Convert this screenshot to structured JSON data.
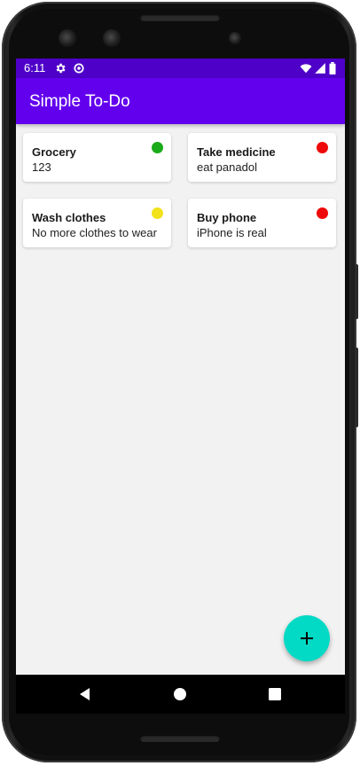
{
  "status_bar": {
    "time": "6:11",
    "background": "#4e00c8",
    "icons": [
      "settings-icon",
      "data-saver-icon",
      "wifi-icon",
      "cell-signal-icon",
      "battery-icon"
    ]
  },
  "app_bar": {
    "title": "Simple To-Do",
    "background": "#6200ee"
  },
  "tasks": [
    {
      "title": "Grocery",
      "description": "123",
      "status_color": "#1aab1a",
      "status": "green"
    },
    {
      "title": "Take medicine",
      "description": "eat panadol",
      "status_color": "#ee0a0a",
      "status": "red"
    },
    {
      "title": "Wash clothes",
      "description": "No more clothes to wear",
      "status_color": "#f2e21a",
      "status": "yellow"
    },
    {
      "title": "Buy phone",
      "description": "iPhone is real",
      "status_color": "#ee0a0a",
      "status": "red"
    }
  ],
  "fab": {
    "icon": "add-icon",
    "color": "#03dac5"
  },
  "nav": {
    "buttons": [
      "back-icon",
      "home-icon",
      "recents-icon"
    ]
  }
}
